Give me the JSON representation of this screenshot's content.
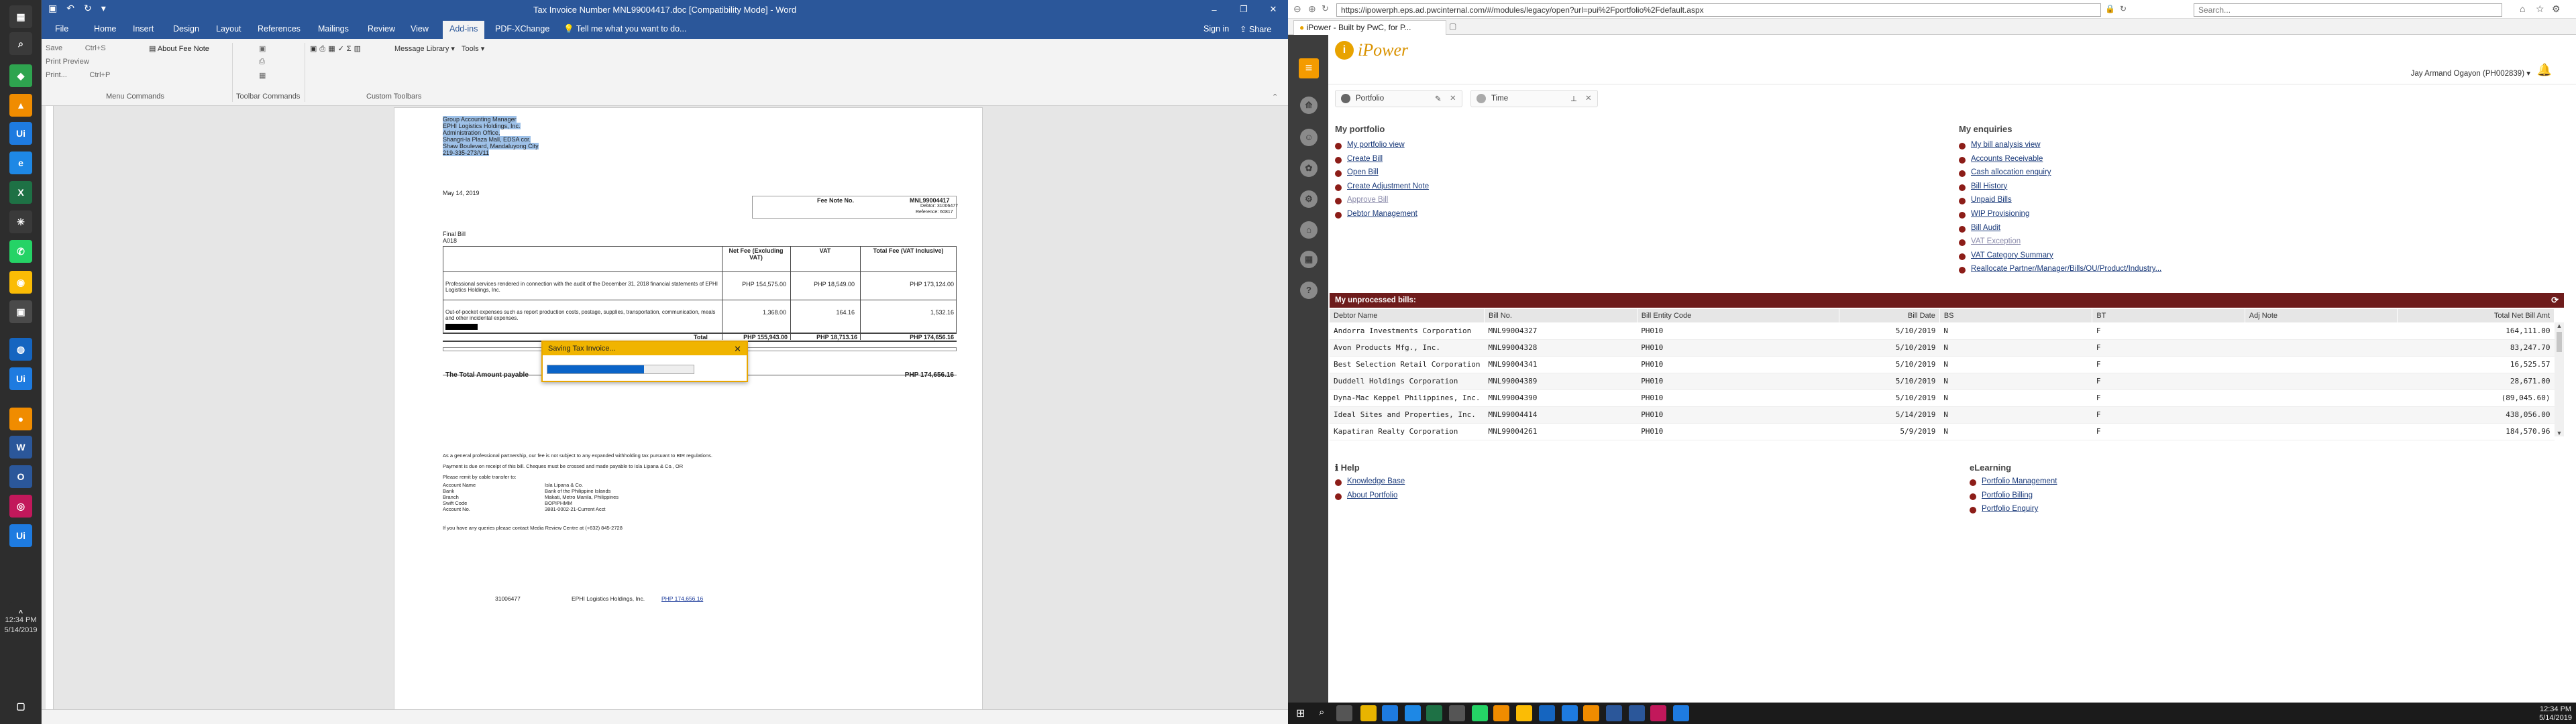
{
  "sidebar": {
    "time": "12:34 PM",
    "date": "5/14/2019"
  },
  "word": {
    "title": "Tax Invoice Number MNL99004417.doc [Compatibility Mode] - Word",
    "menu": {
      "file": "File",
      "home": "Home",
      "insert": "Insert",
      "design": "Design",
      "layout": "Layout",
      "references": "References",
      "mailings": "Mailings",
      "review": "Review",
      "view": "View",
      "addins": "Add-ins",
      "pdfx": "PDF-XChange",
      "tell": "Tell me what you want to do...",
      "signin": "Sign in",
      "share": "Share"
    },
    "ribbon": {
      "save": "Save",
      "save_sc": "Ctrl+S",
      "print_preview": "Print Preview",
      "print": "Print...",
      "print_sc": "Ctrl+P",
      "about_fee": "About Fee Note",
      "message_library": "Message Library",
      "tools": "Tools",
      "grp_menu": "Menu Commands",
      "grp_toolbar": "Toolbar Commands",
      "grp_custom": "Custom Toolbars"
    },
    "doc": {
      "addr1": "Group Accounting Manager",
      "addr2": "EPHI Logistics Holdings, Inc.",
      "addr3": "Administration Office,",
      "addr4": "Shangri-la Plaza Mall, EDSA cor.",
      "addr5": "Shaw Boulevard, Mandaluyong City",
      "addr6": "219-335-273/V11",
      "date": "May 14, 2019",
      "fee_note_label": "Fee Note No.",
      "fee_note_no": "MNL99004417",
      "debtor": "Debtor: 31006477",
      "reference": "Reference: 60817",
      "final_bill": "Final Bill",
      "a": "A018",
      "h_net": "Net Fee (Excluding VAT)",
      "h_vat": "VAT",
      "h_total": "Total Fee (VAT Inclusive)",
      "row1_desc": "Professional services rendered in connection with the audit of the December 31, 2018 financial statements of EPHI Logistics Holdings, Inc.",
      "row1_net": "PHP 154,575.00",
      "row1_vat": "PHP 18,549.00",
      "row1_total": "PHP 173,124.00",
      "row2_desc": "Out-of-pocket expenses such as report production costs, postage, supplies, transportation, communication, meals and other incidental expenses.",
      "row2_net": "1,368.00",
      "row2_vat": "164.16",
      "row2_total": "1,532.16",
      "total_label": "Total",
      "total_net": "PHP 155,943.00",
      "total_vat": "PHP 18,713.16",
      "total_total": "PHP 174,656.16",
      "amount_payable": "The Total Amount payable",
      "amount_payable_value": "PHP 174,656.16",
      "note1": "As a general professional partnership, our fee is not subject to any expanded withholding tax pursuant to BIR regulations.",
      "note2": "Payment is due on receipt of this bill. Cheques must be crossed and made payable to Isla Lipana & Co., OR",
      "note3": "Please remit by cable transfer to:",
      "bank_labels": [
        "Account Name",
        "Bank",
        "Branch",
        "Swift Code",
        "Account No."
      ],
      "bank_values": [
        "Isla Lipana & Co.",
        "Bank of the Philippine Islands",
        "Makati, Metro Manila, Philippines",
        "BOPIPHMM",
        "3881-0002-21-Current Acct"
      ],
      "queries": "If you have any queries please contact Media Review Centre at (+632) 845-2728",
      "footer_debtor": "31006477",
      "footer_name": "EPHI Logistics Holdings, Inc.",
      "footer_amount": "PHP 174,656.16"
    },
    "dialog": {
      "title": "Saving Tax Invoice...",
      "progress": 0.66
    }
  },
  "browser": {
    "url": "https://ipowerph.eps.ad.pwcinternal.com/#/modules/legacy/open?url=pui%2Fportfolio%2Fdefault.aspx",
    "search_placeholder": "Search...",
    "tab": "iPower - Built by PwC, for P..."
  },
  "ipower": {
    "logo": "iPower",
    "user": "Jay Armand Ogayon (PH002839)",
    "pills": [
      "Portfolio",
      "Time"
    ],
    "my_portfolio": {
      "title": "My portfolio",
      "links": [
        "My portfolio view",
        "Create Bill",
        "Open Bill",
        "Create Adjustment Note",
        "Approve Bill",
        "Debtor Management"
      ]
    },
    "my_enquiries": {
      "title": "My enquiries",
      "links": [
        "My bill analysis view",
        "Accounts Receivable",
        "Cash allocation enquiry",
        "Bill History",
        "Unpaid Bills",
        "WIP Provisioning",
        "Bill Audit",
        "VAT Exception",
        "VAT Category Summary",
        "Reallocate Partner/Manager/Bills/OU/Product/Industry..."
      ]
    },
    "unprocessed": {
      "title": "My unprocessed bills:",
      "columns": [
        "Debtor Name",
        "Bill No.",
        "Bill Entity Code",
        "Bill Date",
        "BS",
        "BT",
        "Adj Note",
        "Total Net Bill Amt"
      ],
      "rows": [
        [
          "Andorra Investments Corporation",
          "MNL99004327",
          "PH010",
          "5/10/2019",
          "N",
          "F",
          "",
          "164,111.00"
        ],
        [
          "Avon Products Mfg., Inc.",
          "MNL99004328",
          "PH010",
          "5/10/2019",
          "N",
          "F",
          "",
          "83,247.70"
        ],
        [
          "Best Selection Retail Corporation",
          "MNL99004341",
          "PH010",
          "5/10/2019",
          "N",
          "F",
          "",
          "16,525.57"
        ],
        [
          "Duddell Holdings Corporation",
          "MNL99004389",
          "PH010",
          "5/10/2019",
          "N",
          "F",
          "",
          "28,671.00"
        ],
        [
          "Dyna-Mac Keppel Philippines, Inc.",
          "MNL99004390",
          "PH010",
          "5/10/2019",
          "N",
          "F",
          "",
          "(89,045.60)"
        ],
        [
          "Ideal Sites and Properties, Inc.",
          "MNL99004414",
          "PH010",
          "5/14/2019",
          "N",
          "F",
          "",
          "438,056.00"
        ],
        [
          "Kapatiran Realty Corporation",
          "MNL99004261",
          "PH010",
          "5/9/2019",
          "N",
          "F",
          "",
          "184,570.96"
        ]
      ]
    },
    "help": {
      "title": "Help",
      "links": [
        "Knowledge Base",
        "About Portfolio"
      ]
    },
    "elearning": {
      "title": "eLearning",
      "links": [
        "Portfolio Management",
        "Portfolio Billing",
        "Portfolio Enquiry"
      ]
    }
  },
  "taskbar": {
    "time": "12:34 PM",
    "date": "5/14/2019"
  }
}
